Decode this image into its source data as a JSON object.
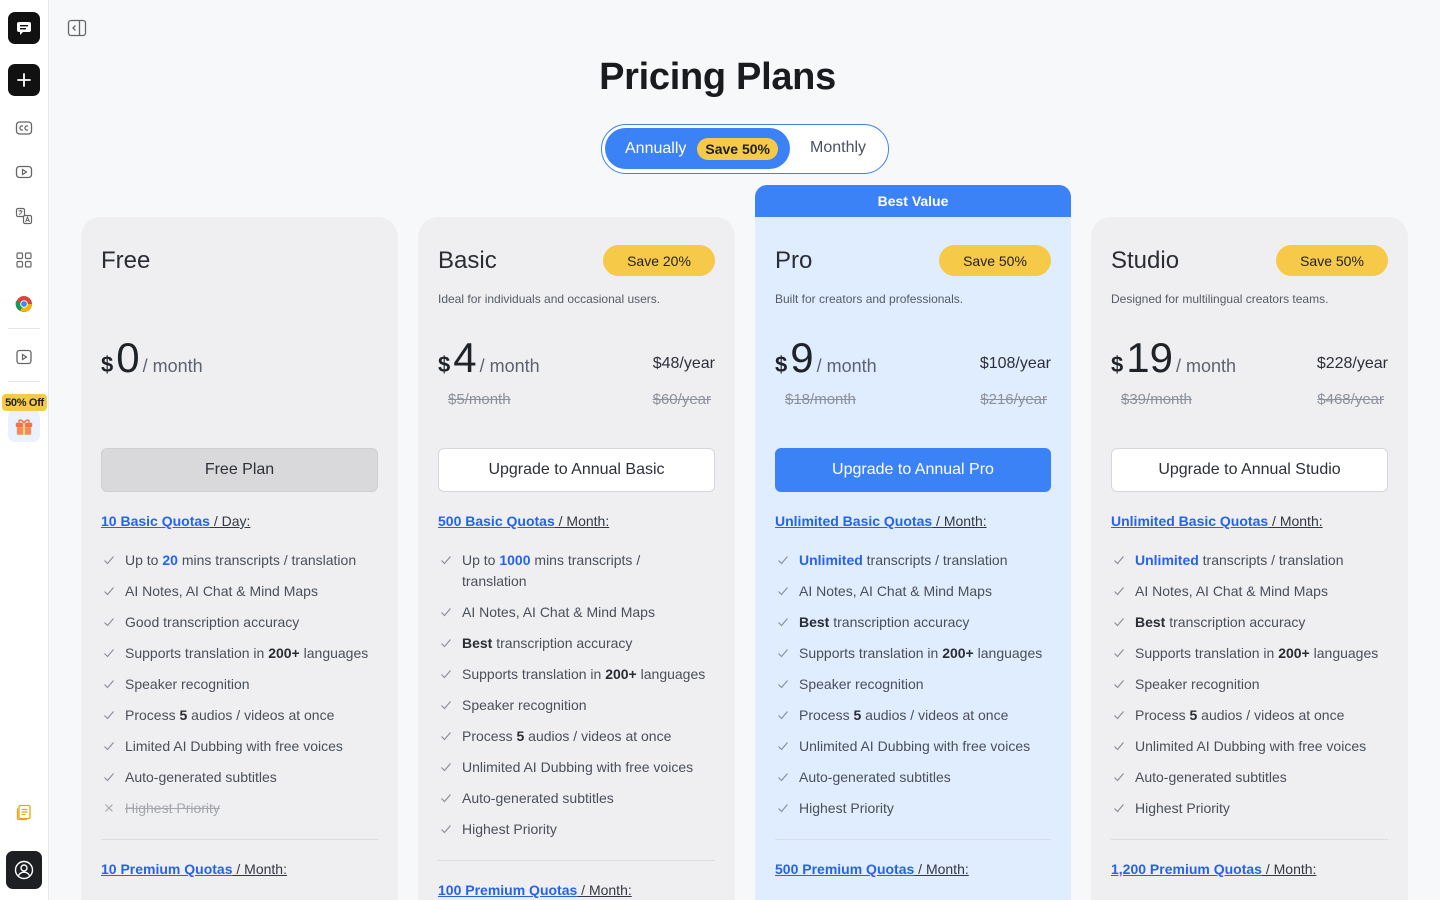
{
  "sidebar": {
    "badge": "50% Off"
  },
  "page": {
    "title": "Pricing Plans"
  },
  "toggle": {
    "annual_label": "Annually",
    "annual_save": "Save 50%",
    "monthly_label": "Monthly"
  },
  "best_value": "Best Value",
  "plans": [
    {
      "name": "Free",
      "save": "",
      "desc": "",
      "currency": "$",
      "amount": "0",
      "per": "/ month",
      "year": "",
      "old_month": "",
      "old_year": "",
      "cta": "Free Plan",
      "quota_link": "10 Basic Quotas",
      "quota_suffix": " / Day:",
      "features": [
        {
          "pre": "Up to ",
          "bold": "20",
          "bold_style": "blue",
          "post": " mins transcripts / translation",
          "off": false
        },
        {
          "pre": "AI Notes, AI Chat & Mind Maps",
          "bold": "",
          "bold_style": "",
          "post": "",
          "off": false
        },
        {
          "pre": "Good transcription accuracy",
          "bold": "",
          "bold_style": "",
          "post": "",
          "off": false
        },
        {
          "pre": "Supports translation in ",
          "bold": "200+",
          "bold_style": "dark",
          "post": " languages",
          "off": false
        },
        {
          "pre": "Speaker recognition",
          "bold": "",
          "bold_style": "",
          "post": "",
          "off": false
        },
        {
          "pre": "Process ",
          "bold": "5",
          "bold_style": "dark",
          "post": " audios / videos at once",
          "off": false
        },
        {
          "pre": "Limited AI Dubbing with free voices",
          "bold": "",
          "bold_style": "",
          "post": "",
          "off": false
        },
        {
          "pre": "Auto-generated subtitles",
          "bold": "",
          "bold_style": "",
          "post": "",
          "off": false
        },
        {
          "pre": "Highest Priority",
          "bold": "",
          "bold_style": "",
          "post": "",
          "off": true
        }
      ],
      "premium_link": "10 Premium Quotas",
      "premium_suffix": " / Month:"
    },
    {
      "name": "Basic",
      "save": "Save 20%",
      "desc": "Ideal for individuals and occasional users.",
      "currency": "$",
      "amount": "4",
      "per": "/ month",
      "year": "$48/year",
      "old_month": "$5/month",
      "old_year": "$60/year",
      "cta": "Upgrade to Annual Basic",
      "quota_link": "500 Basic Quotas",
      "quota_suffix": " / Month:",
      "features": [
        {
          "pre": "Up to ",
          "bold": "1000",
          "bold_style": "blue",
          "post": " mins transcripts / translation",
          "off": false
        },
        {
          "pre": "AI Notes, AI Chat & Mind Maps",
          "bold": "",
          "bold_style": "",
          "post": "",
          "off": false
        },
        {
          "pre": "",
          "bold": "Best",
          "bold_style": "dark",
          "post": " transcription accuracy",
          "off": false
        },
        {
          "pre": "Supports translation in ",
          "bold": "200+",
          "bold_style": "dark",
          "post": " languages",
          "off": false
        },
        {
          "pre": "Speaker recognition",
          "bold": "",
          "bold_style": "",
          "post": "",
          "off": false
        },
        {
          "pre": "Process ",
          "bold": "5",
          "bold_style": "dark",
          "post": " audios / videos at once",
          "off": false
        },
        {
          "pre": "Unlimited AI Dubbing with free voices",
          "bold": "",
          "bold_style": "",
          "post": "",
          "off": false
        },
        {
          "pre": "Auto-generated subtitles",
          "bold": "",
          "bold_style": "",
          "post": "",
          "off": false
        },
        {
          "pre": "Highest Priority",
          "bold": "",
          "bold_style": "",
          "post": "",
          "off": false
        }
      ],
      "premium_link": "100 Premium Quotas",
      "premium_suffix": " / Month:"
    },
    {
      "name": "Pro",
      "save": "Save 50%",
      "desc": "Built for creators and professionals.",
      "currency": "$",
      "amount": "9",
      "per": "/ month",
      "year": "$108/year",
      "old_month": "$18/month",
      "old_year": "$216/year",
      "cta": "Upgrade to Annual Pro",
      "quota_link": "Unlimited Basic Quotas",
      "quota_suffix": " / Month:",
      "features": [
        {
          "pre": "",
          "bold": "Unlimited",
          "bold_style": "blue",
          "post": " transcripts / translation",
          "off": false
        },
        {
          "pre": "AI Notes, AI Chat & Mind Maps",
          "bold": "",
          "bold_style": "",
          "post": "",
          "off": false
        },
        {
          "pre": "",
          "bold": "Best",
          "bold_style": "dark",
          "post": " transcription accuracy",
          "off": false
        },
        {
          "pre": "Supports translation in ",
          "bold": "200+",
          "bold_style": "dark",
          "post": " languages",
          "off": false
        },
        {
          "pre": "Speaker recognition",
          "bold": "",
          "bold_style": "",
          "post": "",
          "off": false
        },
        {
          "pre": "Process ",
          "bold": "5",
          "bold_style": "dark",
          "post": " audios / videos at once",
          "off": false
        },
        {
          "pre": "Unlimited AI Dubbing with free voices",
          "bold": "",
          "bold_style": "",
          "post": "",
          "off": false
        },
        {
          "pre": "Auto-generated subtitles",
          "bold": "",
          "bold_style": "",
          "post": "",
          "off": false
        },
        {
          "pre": "Highest Priority",
          "bold": "",
          "bold_style": "",
          "post": "",
          "off": false
        }
      ],
      "premium_link": "500 Premium Quotas",
      "premium_suffix": " / Month:"
    },
    {
      "name": "Studio",
      "save": "Save 50%",
      "desc": "Designed for multilingual creators teams.",
      "currency": "$",
      "amount": "19",
      "per": "/ month",
      "year": "$228/year",
      "old_month": "$39/month",
      "old_year": "$468/year",
      "cta": "Upgrade to Annual Studio",
      "quota_link": "Unlimited Basic Quotas",
      "quota_suffix": " / Month:",
      "features": [
        {
          "pre": "",
          "bold": "Unlimited",
          "bold_style": "blue",
          "post": " transcripts / translation",
          "off": false
        },
        {
          "pre": "AI Notes, AI Chat & Mind Maps",
          "bold": "",
          "bold_style": "",
          "post": "",
          "off": false
        },
        {
          "pre": "",
          "bold": "Best",
          "bold_style": "dark",
          "post": " transcription accuracy",
          "off": false
        },
        {
          "pre": "Supports translation in ",
          "bold": "200+",
          "bold_style": "dark",
          "post": " languages",
          "off": false
        },
        {
          "pre": "Speaker recognition",
          "bold": "",
          "bold_style": "",
          "post": "",
          "off": false
        },
        {
          "pre": "Process ",
          "bold": "5",
          "bold_style": "dark",
          "post": " audios / videos at once",
          "off": false
        },
        {
          "pre": "Unlimited AI Dubbing with free voices",
          "bold": "",
          "bold_style": "",
          "post": "",
          "off": false
        },
        {
          "pre": "Auto-generated subtitles",
          "bold": "",
          "bold_style": "",
          "post": "",
          "off": false
        },
        {
          "pre": "Highest Priority",
          "bold": "",
          "bold_style": "",
          "post": "",
          "off": false
        }
      ],
      "premium_link": "1,200 Premium Quotas",
      "premium_suffix": " / Month:"
    }
  ],
  "colors": {
    "accent": "#3b82f6",
    "save_badge": "#f7c948",
    "pro_card": "#e0edff",
    "card": "#efeff1"
  },
  "icons": [
    "chat-logo-icon",
    "plus-icon",
    "cc-icon",
    "youtube-icon",
    "translate-icon",
    "apps-icon",
    "chrome-icon",
    "video-icon",
    "gift-icon",
    "files-icon",
    "user-icon",
    "sidebar-collapse-icon",
    "check-icon",
    "cross-icon"
  ]
}
